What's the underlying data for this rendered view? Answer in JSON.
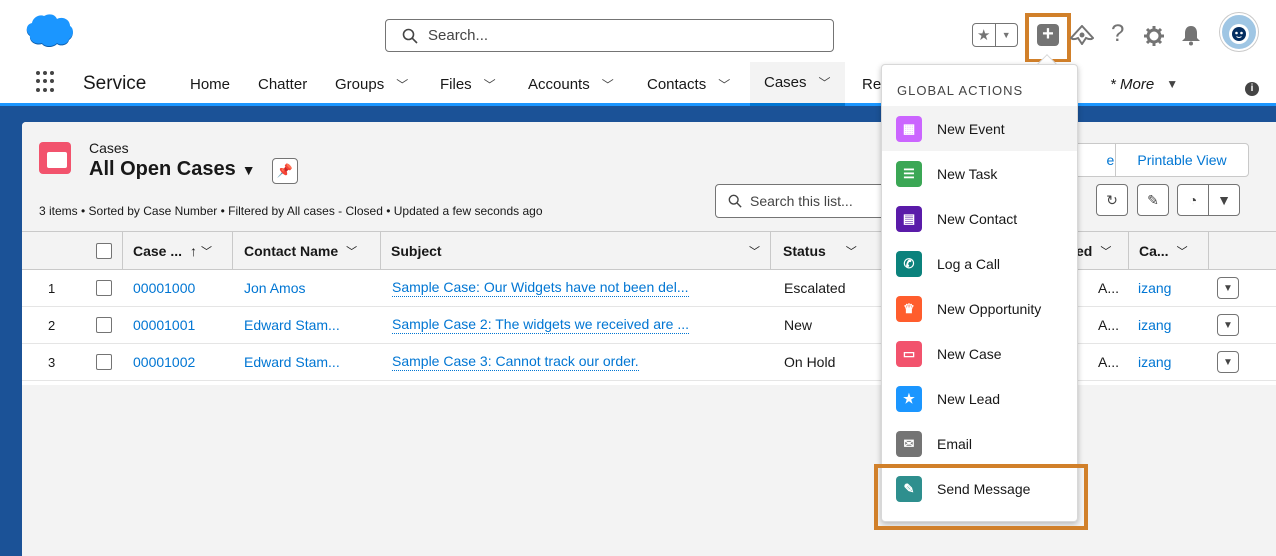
{
  "header": {
    "search_placeholder": "Search...",
    "icons": [
      "cloud-logo",
      "favorites-star-icon",
      "favorites-menu-chevron-icon",
      "global-add-icon",
      "trailhead-guidance-icon",
      "help-icon",
      "setup-gear-icon",
      "notifications-bell-icon",
      "user-avatar"
    ]
  },
  "nav": {
    "app_name": "Service",
    "items": [
      {
        "label": "Home",
        "has_menu": false
      },
      {
        "label": "Chatter",
        "has_menu": false
      },
      {
        "label": "Groups",
        "has_menu": true
      },
      {
        "label": "Files",
        "has_menu": true
      },
      {
        "label": "Accounts",
        "has_menu": true
      },
      {
        "label": "Contacts",
        "has_menu": true
      },
      {
        "label": "Cases",
        "has_menu": true,
        "active": true
      },
      {
        "label": "Re",
        "has_menu": false
      }
    ],
    "more_label": "* More"
  },
  "list": {
    "object_label": "Cases",
    "title": "All Open Cases",
    "meta": "3 items • Sorted by Case Number • Filtered by All cases - Closed • Updated a few seconds ago",
    "search_placeholder": "Search this list...",
    "buttons": {
      "partial_left": "er",
      "printable_view": "Printable View"
    },
    "columns": {
      "case_number": "Case ...",
      "contact_name": "Contact Name",
      "subject": "Subject",
      "status": "Status",
      "date_opened": "ed",
      "case_owner": "Ca..."
    },
    "rows": [
      {
        "num": "1",
        "case_number": "00001000",
        "contact": "Jon Amos",
        "subject": "Sample Case: Our Widgets have not been del...",
        "status": "Escalated",
        "date": "A...",
        "owner": "izang"
      },
      {
        "num": "2",
        "case_number": "00001001",
        "contact": "Edward Stam...",
        "subject": "Sample Case 2: The widgets we received are ...",
        "status": "New",
        "date": "A...",
        "owner": "izang"
      },
      {
        "num": "3",
        "case_number": "00001002",
        "contact": "Edward Stam...",
        "subject": "Sample Case 3: Cannot track our order.",
        "status": "On Hold",
        "date": "A...",
        "owner": "izang"
      }
    ]
  },
  "global_actions": {
    "header": "GLOBAL ACTIONS",
    "items": [
      {
        "label": "New Event",
        "color": "#cb65ff",
        "icon": "event-icon"
      },
      {
        "label": "New Task",
        "color": "#3ba755",
        "icon": "task-icon"
      },
      {
        "label": "New Contact",
        "color": "#5a1ba9",
        "icon": "contact-icon"
      },
      {
        "label": "Log a Call",
        "color": "#0b827c",
        "icon": "call-log-icon"
      },
      {
        "label": "New Opportunity",
        "color": "#ff5d2d",
        "icon": "opportunity-crown-icon"
      },
      {
        "label": "New Case",
        "color": "#f2536d",
        "icon": "case-icon"
      },
      {
        "label": "New Lead",
        "color": "#1b96ff",
        "icon": "lead-icon"
      },
      {
        "label": "Email",
        "color": "#747474",
        "icon": "email-icon"
      },
      {
        "label": "Send Message",
        "color": "#2e8f8e",
        "icon": "message-icon"
      }
    ]
  },
  "colors": {
    "highlight": "#d1802a",
    "brand_blue": "#0176d3",
    "nav_accent": "#1b96ff",
    "banner_bg": "#1b5297"
  }
}
